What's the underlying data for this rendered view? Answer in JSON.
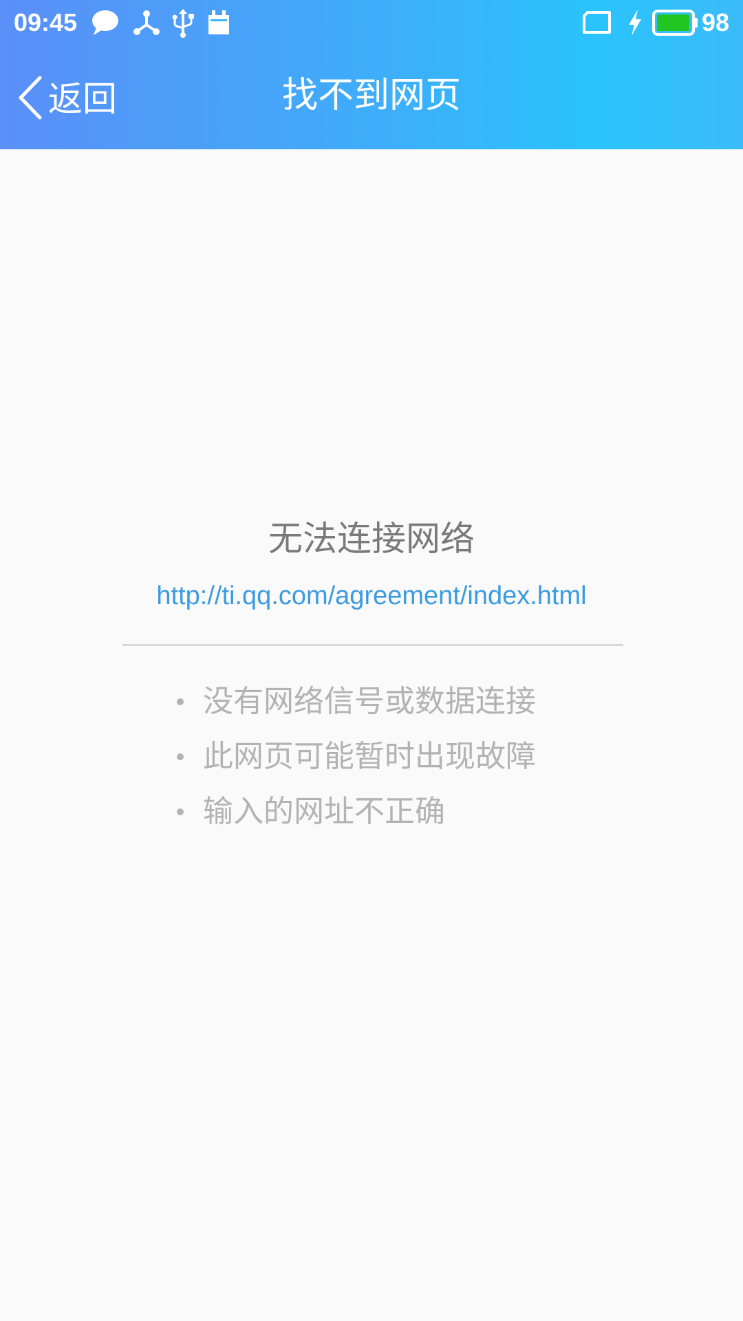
{
  "status_bar": {
    "time": "09:45",
    "battery_level": "98",
    "battery_fill": 0.98,
    "icons": [
      "chat-bubble-icon",
      "network-share-icon",
      "usb-icon",
      "calendar-icon",
      "tablet-icon",
      "charging-bolt-icon",
      "battery-icon"
    ],
    "battery_color": "#22c622"
  },
  "header": {
    "back_label": "返回",
    "title": "找不到网页",
    "gradient_start": "#5a8ff7",
    "gradient_end": "#2ac3fd"
  },
  "error": {
    "title": "无法连接网络",
    "url": "http://ti.qq.com/agreement/index.html",
    "reasons": [
      "没有网络信号或数据连接",
      "此网页可能暂时出现故障",
      "输入的网址不正确"
    ]
  }
}
